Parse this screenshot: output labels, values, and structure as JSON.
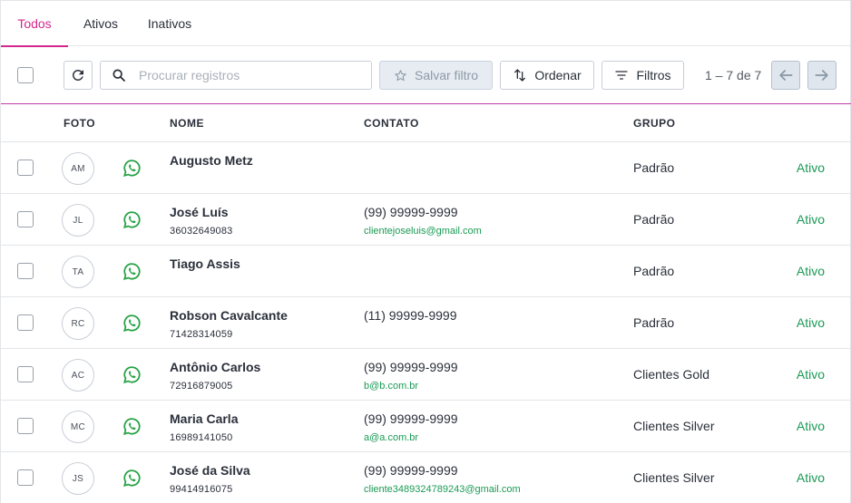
{
  "tabs": [
    {
      "label": "Todos",
      "active": true
    },
    {
      "label": "Ativos",
      "active": false
    },
    {
      "label": "Inativos",
      "active": false
    }
  ],
  "toolbar": {
    "refresh_icon": "refresh-icon",
    "search_placeholder": "Procurar registros",
    "search_value": "",
    "save_filter_label": "Salvar filtro",
    "sort_label": "Ordenar",
    "filters_label": "Filtros",
    "pagination": "1 – 7 de 7"
  },
  "columns": {
    "photo": "FOTO",
    "name": "NOME",
    "contact": "CONTATO",
    "group": "GRUPO"
  },
  "colors": {
    "accent": "#d3278e",
    "active_status": "#1a9a55",
    "whatsapp": "#25a244"
  },
  "rows": [
    {
      "initials": "AM",
      "name": "Augusto Metz",
      "doc": "",
      "phone": "",
      "email": "",
      "group": "Padrão",
      "status": "Ativo"
    },
    {
      "initials": "JL",
      "name": "José Luís",
      "doc": "36032649083",
      "phone": "(99) 99999-9999",
      "email": "clientejoseluis@gmail.com",
      "group": "Padrão",
      "status": "Ativo"
    },
    {
      "initials": "TA",
      "name": "Tiago Assis",
      "doc": "",
      "phone": "",
      "email": "",
      "group": "Padrão",
      "status": "Ativo"
    },
    {
      "initials": "RC",
      "name": "Robson Cavalcante",
      "doc": "71428314059",
      "phone": "(11) 99999-9999",
      "email": "",
      "group": "Padrão",
      "status": "Ativo"
    },
    {
      "initials": "AC",
      "name": "Antônio Carlos",
      "doc": "72916879005",
      "phone": "(99) 99999-9999",
      "email": "b@b.com.br",
      "group": "Clientes Gold",
      "status": "Ativo"
    },
    {
      "initials": "MC",
      "name": "Maria Carla",
      "doc": "16989141050",
      "phone": "(99) 99999-9999",
      "email": "a@a.com.br",
      "group": "Clientes Silver",
      "status": "Ativo"
    },
    {
      "initials": "JS",
      "name": "José da Silva",
      "doc": "99414916075",
      "phone": "(99) 99999-9999",
      "email": "cliente3489324789243@gmail.com",
      "group": "Clientes Silver",
      "status": "Ativo"
    }
  ]
}
